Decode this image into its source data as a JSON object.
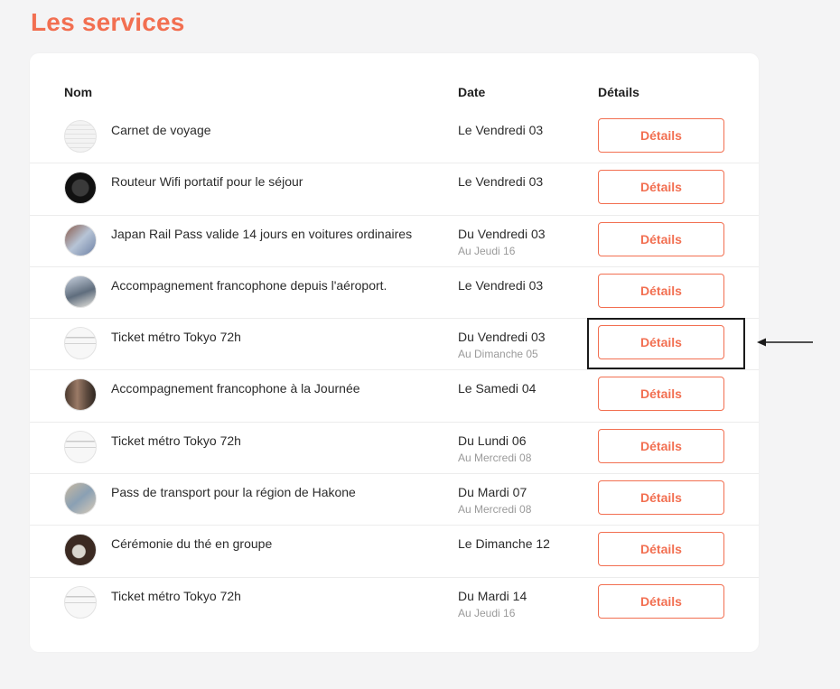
{
  "page": {
    "title": "Les services",
    "accent_color": "#f26f51"
  },
  "table": {
    "headers": {
      "name": "Nom",
      "date": "Date",
      "details": "Détails"
    },
    "rows": [
      {
        "avatar_icon": "notebook-icon",
        "name": "Carnet de voyage",
        "date": "Le Vendredi 03",
        "date_end": "",
        "button": "Détails"
      },
      {
        "avatar_icon": "wifi-router-icon",
        "name": "Routeur Wifi portatif pour le séjour",
        "date": "Le Vendredi 03",
        "date_end": "",
        "button": "Détails"
      },
      {
        "avatar_icon": "train-pass-icon",
        "name": "Japan Rail Pass valide 14 jours en voitures ordinaires",
        "date": "Du Vendredi 03",
        "date_end": "Au Jeudi 16",
        "button": "Détails"
      },
      {
        "avatar_icon": "guide-icon",
        "name": "Accompagnement francophone depuis l'aéroport.",
        "date": "Le Vendredi 03",
        "date_end": "",
        "button": "Détails"
      },
      {
        "avatar_icon": "metro-ticket-icon",
        "name": "Ticket métro Tokyo 72h",
        "date": "Du Vendredi 03",
        "date_end": "Au Dimanche 05",
        "button": "Détails"
      },
      {
        "avatar_icon": "street-icon",
        "name": "Accompagnement francophone à la Journée",
        "date": "Le Samedi 04",
        "date_end": "",
        "button": "Détails"
      },
      {
        "avatar_icon": "metro-ticket-icon",
        "name": "Ticket métro Tokyo 72h",
        "date": "Du Lundi 06",
        "date_end": "Au Mercredi 08",
        "button": "Détails"
      },
      {
        "avatar_icon": "hakone-pass-icon",
        "name": "Pass de transport pour la région de Hakone",
        "date": "Du Mardi 07",
        "date_end": "Au Mercredi 08",
        "button": "Détails"
      },
      {
        "avatar_icon": "tea-ceremony-icon",
        "name": "Cérémonie du thé en groupe",
        "date": "Le Dimanche 12",
        "date_end": "",
        "button": "Détails"
      },
      {
        "avatar_icon": "metro-ticket-icon",
        "name": "Ticket métro Tokyo 72h",
        "date": "Du Mardi 14",
        "date_end": "Au Jeudi 16",
        "button": "Détails"
      }
    ]
  },
  "annotation": {
    "highlighted_row_index": 4,
    "arrow_icon": "left-arrow-icon"
  }
}
